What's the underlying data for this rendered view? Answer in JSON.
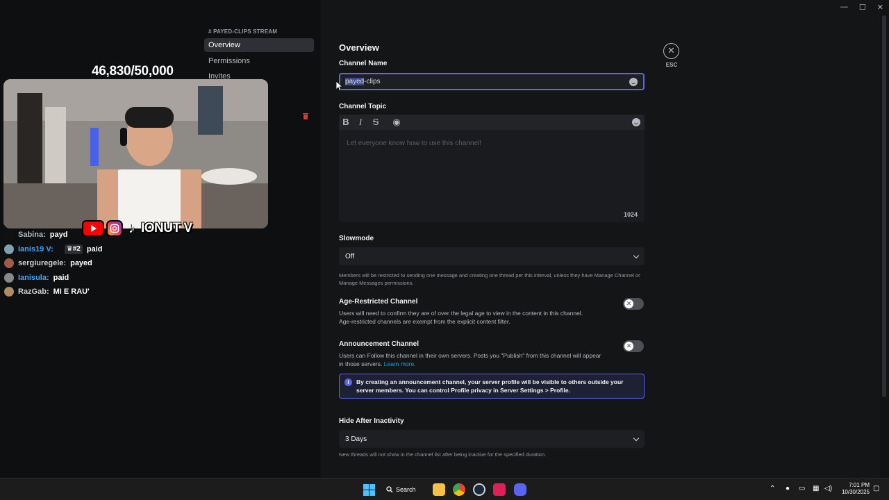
{
  "stream": {
    "counter": "46,830/50,000",
    "social_name": "IONUT V",
    "chat": [
      {
        "user": "Sabina:",
        "msg": "payd",
        "user_color": "#b5bac1",
        "avatar_color": "#111111",
        "badge": ""
      },
      {
        "user": "Ianis19 V:",
        "msg": "paid",
        "user_color": "#3ea6ff",
        "avatar_color": "#7fa0b0",
        "badge": "#2"
      },
      {
        "user": "sergiuregele:",
        "msg": "payed",
        "user_color": "#d0d0d0",
        "avatar_color": "#a05a4a",
        "badge": ""
      },
      {
        "user": "Ianisula:",
        "msg": "paid",
        "user_color": "#3ea6ff",
        "avatar_color": "#888888",
        "badge": ""
      },
      {
        "user": "RazGab:",
        "msg": "MI E RAU'",
        "user_color": "#d0d0d0",
        "avatar_color": "#b08a60",
        "badge": ""
      }
    ]
  },
  "sidebar": {
    "header": "# PAYED-CLIPS STREAM",
    "items": [
      {
        "label": "Overview",
        "active": true
      },
      {
        "label": "Permissions",
        "active": false
      },
      {
        "label": "Invites",
        "active": false
      }
    ]
  },
  "settings": {
    "title": "Overview",
    "channel_name_label": "Channel Name",
    "channel_name_selected": "payed",
    "channel_name_rest": "-clips",
    "channel_topic_label": "Channel Topic",
    "topic_placeholder": "Let everyone know how to use this channel!",
    "topic_char_count": "1024",
    "toolbar": {
      "bold": "B",
      "italic": "I",
      "strike": "S"
    },
    "slowmode_label": "Slowmode",
    "slowmode_value": "Off",
    "slowmode_help": "Members will be restricted to sending one message and creating one thread per this interval, unless they have Manage Channel or Manage Messages permissions.",
    "age_label": "Age-Restricted Channel",
    "age_help_1": "Users will need to confirm they are of over the legal age to view in the content in this channel.",
    "age_help_2": "Age-restricted channels are exempt from the explicit content filter.",
    "announce_label": "Announcement Channel",
    "announce_help": "Users can Follow this channel in their own servers. Posts you \"Publish\" from this channel will appear in those servers.",
    "learn_more": "Learn more.",
    "notice_text": "By creating an announcement channel, your server profile will be visible to others outside your server members. You can control Profile privacy in Server Settings > Profile.",
    "inactivity_label": "Hide After Inactivity",
    "inactivity_value": "3 Days",
    "inactivity_help": "New threads will not show in the channel list after being inactive for the specified duration.",
    "esc_label": "ESC",
    "toggles": {
      "age_restricted": false,
      "announcement": false
    }
  },
  "taskbar": {
    "search_label": "Search",
    "time": "7:01 PM",
    "date": "10/30/2025",
    "icons": [
      "windows-start",
      "search",
      "file-explorer",
      "chrome",
      "steam",
      "tiktok",
      "discord"
    ]
  }
}
